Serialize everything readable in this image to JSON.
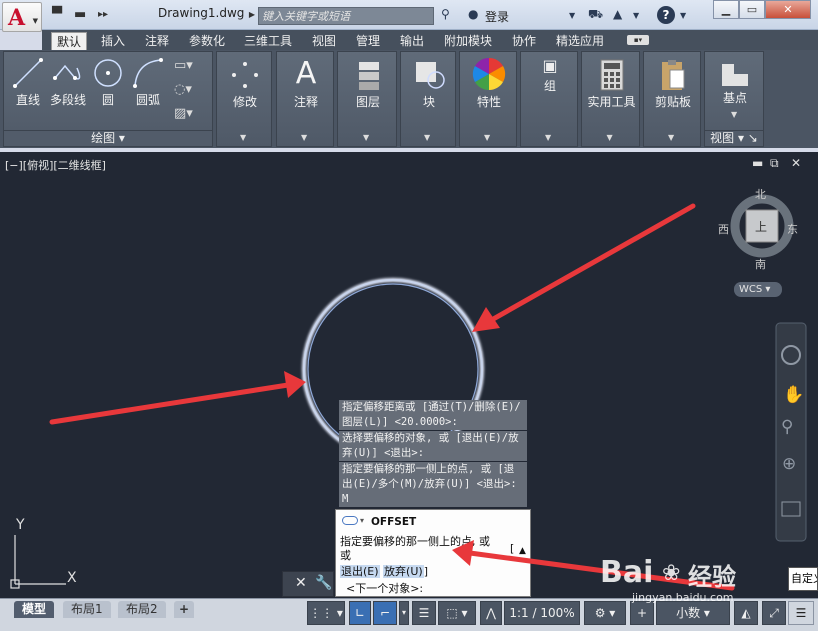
{
  "titlebar": {
    "doc_title": "Drawing1.dwg",
    "search_placeholder": "键入关键字或短语",
    "login": "登录"
  },
  "ribbon_tabs": [
    "默认",
    "插入",
    "注释",
    "参数化",
    "三维工具",
    "视图",
    "管理",
    "输出",
    "附加模块",
    "协作",
    "精选应用"
  ],
  "draw_panel": {
    "buttons": [
      "直线",
      "多段线",
      "圆",
      "圆弧"
    ],
    "footer": "绘图"
  },
  "panels": [
    "修改",
    "注释",
    "图层",
    "块",
    "特性",
    "组",
    "实用工具",
    "剪贴板",
    "基点"
  ],
  "view_footer": "视图",
  "viewport_label": "[−][俯视][二维线框]",
  "viewcube": {
    "north": "北",
    "south": "南",
    "east": "东",
    "west": "西",
    "top": "上",
    "wcs": "WCS"
  },
  "command_history": [
    "指定偏移距离或 [通过(T)/删除(E)/图层(L)] <20.0000>:",
    "选择要偏移的对象, 或 [退出(E)/放弃(U)] <退出>:",
    "指定要偏移的那一侧上的点, 或 [退出(E)/多个(M)/放弃(U)] <退出>: M"
  ],
  "command_line": {
    "name": "OFFSET",
    "prompt": "指定要偏移的那一侧上的点, 或",
    "opt1": "退出(E)",
    "opt2": "放弃(U)",
    "bracket": "]",
    "next": "<下一个对象>:"
  },
  "layout_tabs": [
    "模型",
    "布局1",
    "布局2"
  ],
  "status": {
    "scale": "1:1 / 100%",
    "units": "小数"
  },
  "tooltip": "自定义",
  "watermark": {
    "brand": "Bai",
    "brand_cn": "经验",
    "url": "jingyan.baidu.com"
  },
  "colors": {
    "canvas": "#222834",
    "ribbon": "#4b5563",
    "circle_outer": "#c8d4ec",
    "circle_inner": "#8fa9d9",
    "arrow": "#e8383b"
  }
}
